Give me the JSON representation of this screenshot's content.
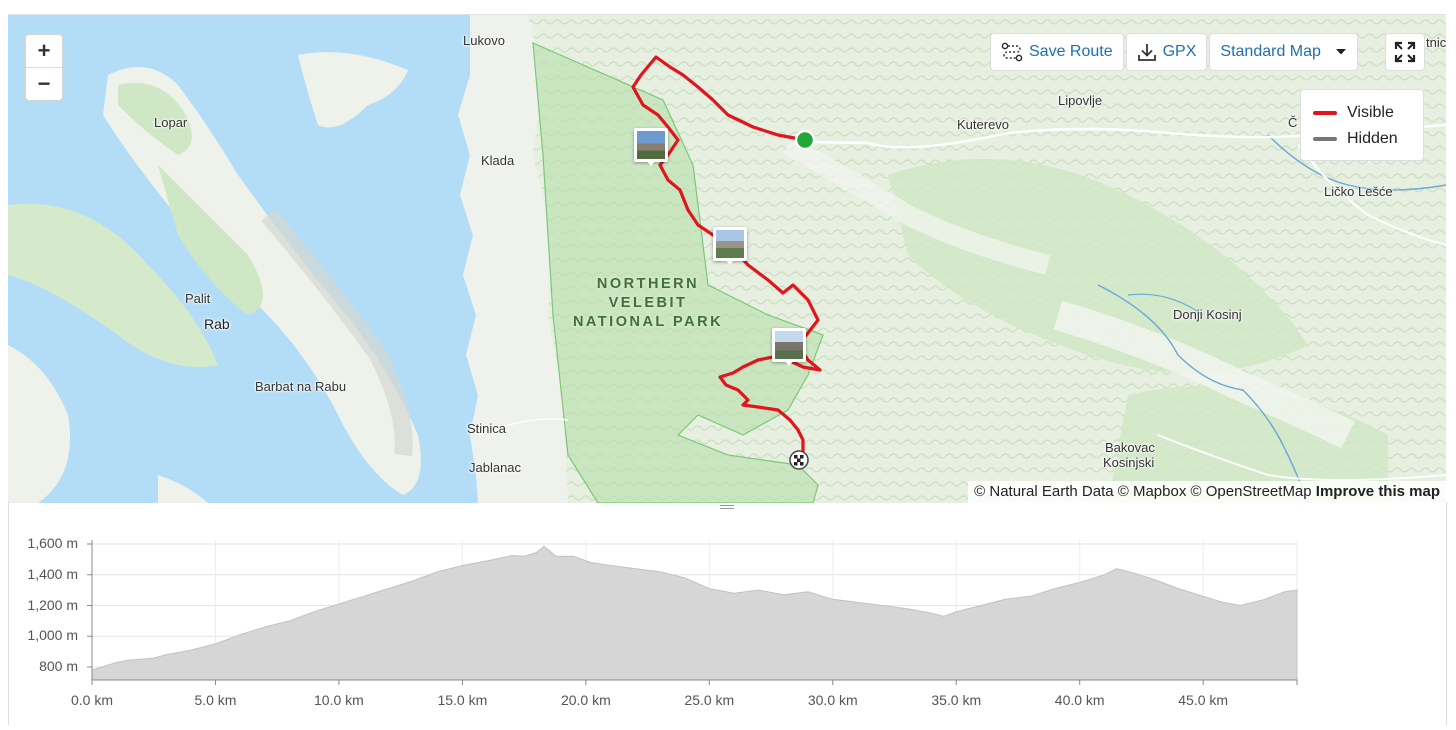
{
  "map": {
    "places": [
      {
        "name": "Lukovo",
        "key": "lukovo"
      },
      {
        "name": "Lopar",
        "key": "lopar"
      },
      {
        "name": "Klada",
        "key": "klada"
      },
      {
        "name": "Palit",
        "key": "palit"
      },
      {
        "name": "Rab",
        "key": "rab"
      },
      {
        "name": "Barbat na Rabu",
        "key": "barbat"
      },
      {
        "name": "Stinica",
        "key": "stinica"
      },
      {
        "name": "Jablanac",
        "key": "jablanac"
      },
      {
        "name": "Lipovlje",
        "key": "lipovlje"
      },
      {
        "name": "Kuterevo",
        "key": "kuterevo"
      },
      {
        "name": "Ličko Lešće",
        "key": "licko"
      },
      {
        "name": "Donji Kosinj",
        "key": "donji"
      },
      {
        "name": "Bakovac",
        "key": "bakovac"
      },
      {
        "name": "Kosinjski",
        "key": "kosinjski"
      },
      {
        "name": "Č",
        "key": "c_partial"
      },
      {
        "name": "tnica",
        "key": "tnica_partial"
      }
    ],
    "park_label": [
      "NORTHERN",
      "VELEBIT",
      "NATIONAL PARK"
    ],
    "attribution": "© Natural Earth Data © Mapbox © OpenStreetMap",
    "attribution_link": "Improve this map",
    "colors": {
      "water": "#b3ddf6",
      "land": "#eef2ea",
      "park": "#c7e6bd",
      "route": "#e0151d",
      "start": "#22a638"
    }
  },
  "controls": {
    "zoom_in": "+",
    "zoom_out": "−",
    "save_route": "Save Route",
    "gpx": "GPX",
    "map_style": "Standard Map",
    "icons": {
      "save": "route-icon",
      "gpx": "download-icon",
      "fullscreen": "expand-icon",
      "dropdown": "caret-down-icon"
    }
  },
  "legend": [
    {
      "label": "Visible",
      "color": "#e0151d"
    },
    {
      "label": "Hidden",
      "color": "#777777"
    }
  ],
  "chart_data": {
    "type": "area",
    "y_ticks": [
      "1,600 m",
      "1,400 m",
      "1,200 m",
      "1,000 m",
      "800 m"
    ],
    "y_tick_values": [
      1600,
      1400,
      1200,
      1000,
      800
    ],
    "x_ticks": [
      "0.0 km",
      "5.0 km",
      "10.0 km",
      "15.0 km",
      "20.0 km",
      "25.0 km",
      "30.0 km",
      "35.0 km",
      "40.0 km",
      "45.0 km"
    ],
    "x_tick_values": [
      0,
      5,
      10,
      15,
      20,
      25,
      30,
      35,
      40,
      45
    ],
    "xlim": [
      0,
      48.8
    ],
    "ylim": [
      700,
      1620
    ],
    "grid": true,
    "x": [
      0,
      1,
      1.5,
      2,
      2.5,
      3,
      4,
      5,
      6,
      7,
      8,
      9,
      10,
      11,
      12,
      13,
      14,
      15,
      16,
      17,
      17.5,
      18,
      18.3,
      18.8,
      19.5,
      20.2,
      21,
      22,
      23,
      24,
      25,
      26,
      27,
      28,
      29,
      30,
      31,
      32,
      33,
      34,
      34.5,
      35,
      36,
      37,
      38,
      39,
      40,
      41,
      41.5,
      42,
      43,
      44,
      45,
      45.8,
      46.5,
      47.5,
      48.3,
      48.8
    ],
    "y": [
      780,
      830,
      845,
      850,
      858,
      880,
      910,
      950,
      1010,
      1060,
      1100,
      1160,
      1210,
      1260,
      1310,
      1360,
      1420,
      1460,
      1490,
      1525,
      1520,
      1545,
      1585,
      1520,
      1520,
      1480,
      1460,
      1440,
      1420,
      1380,
      1310,
      1280,
      1300,
      1270,
      1290,
      1240,
      1220,
      1200,
      1180,
      1150,
      1130,
      1160,
      1200,
      1240,
      1260,
      1310,
      1350,
      1400,
      1440,
      1420,
      1370,
      1310,
      1260,
      1220,
      1200,
      1240,
      1290,
      1300
    ]
  }
}
